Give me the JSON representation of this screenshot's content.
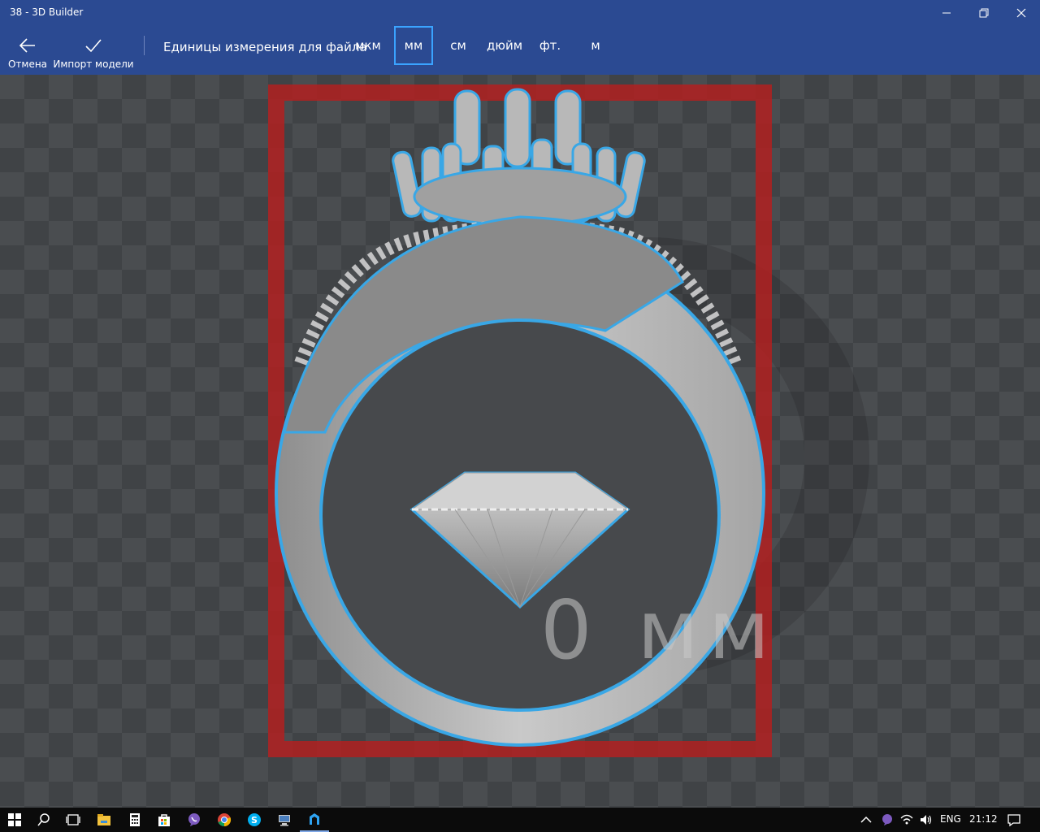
{
  "window": {
    "title": "38 - 3D Builder"
  },
  "commands": {
    "cancel": {
      "label": "Отмена",
      "icon": "back-arrow-icon"
    },
    "import": {
      "label": "Импорт модели",
      "icon": "checkmark-icon"
    }
  },
  "units": {
    "label": "Единицы измерения для файла",
    "options": [
      "мкм",
      "мм",
      "см",
      "дюйм",
      "фт.",
      "м"
    ],
    "selected": "мм"
  },
  "viewport": {
    "size_label": "0 мм"
  },
  "colors": {
    "accent": "#2b4a92",
    "selection": "#3aa3ff",
    "bounding_box": "#b12020"
  },
  "taskbar": {
    "apps": [
      "start-icon",
      "search-icon",
      "task-view-icon",
      "file-explorer-icon",
      "calculator-icon",
      "store-icon",
      "viber-icon",
      "chrome-icon",
      "skype-icon",
      "network-app-icon",
      "3d-builder-icon"
    ],
    "tray": {
      "language": "ENG",
      "time": "21:12"
    }
  }
}
